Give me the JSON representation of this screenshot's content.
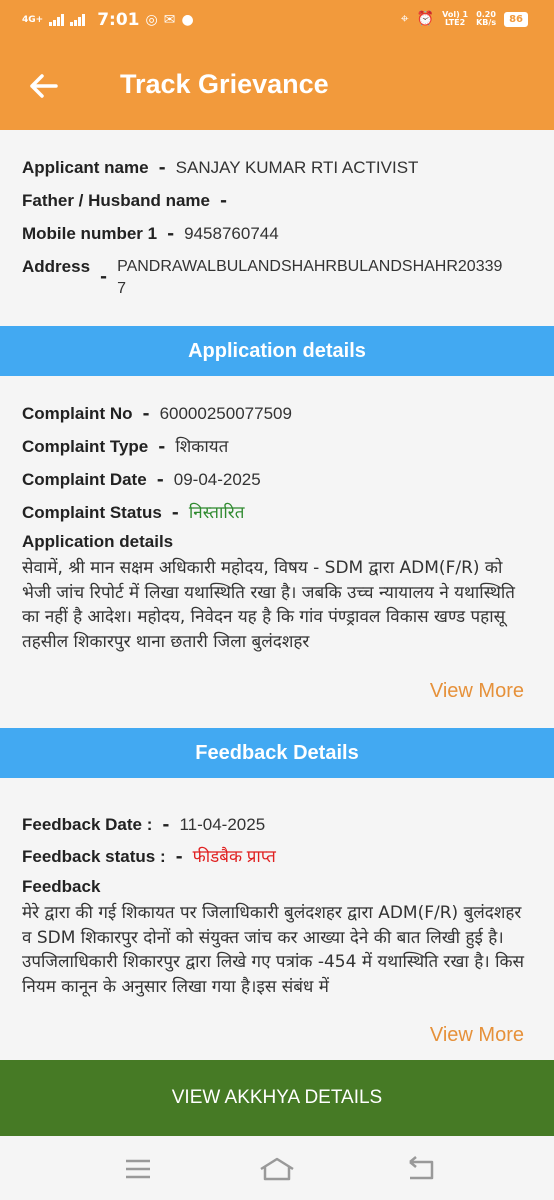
{
  "status_bar": {
    "network": "4G+",
    "time": "7:01",
    "volte": "Vol) 1",
    "lte": "LTE2",
    "speed": "0.20",
    "speed_unit": "KB/s",
    "battery": "86"
  },
  "app_bar": {
    "title": "Track Grievance"
  },
  "applicant": {
    "name_label": "Applicant name",
    "name_value": "SANJAY KUMAR RTI ACTIVIST",
    "father_label": "Father / Husband name",
    "father_value": "",
    "mobile_label": "Mobile number 1",
    "mobile_value": "9458760744",
    "address_label": "Address",
    "address_value": "PANDRAWALBULANDSHAHRBULANDSHAHR203397"
  },
  "application": {
    "section_title": "Application details",
    "complaint_no_label": "Complaint No",
    "complaint_no_value": "60000250077509",
    "complaint_type_label": "Complaint Type",
    "complaint_type_value": "शिकायत",
    "complaint_date_label": "Complaint Date",
    "complaint_date_value": "09-04-2025",
    "complaint_status_label": "Complaint Status",
    "complaint_status_value": "निस्तारित",
    "details_label": "Application details",
    "details_text": "सेवामें,            श्री मान सक्षम अधिकारी महोदय, विषय - SDM द्वारा ADM(F/R) को भेजी जांच रिपोर्ट में लिखा यथास्थिति रखा है। जबकि उच्च न्यायालय ने यथास्थिति का नहीं है आदेश। महोदय,            निवेदन यह है कि गांव पंण्ड्रावल विकास खण्ड पहासू तहसील शिकारपुर थाना छतारी जिला बुलंदशहर",
    "view_more": "View More"
  },
  "feedback": {
    "section_title": "Feedback Details",
    "date_label": "Feedback Date :",
    "date_value": "11-04-2025",
    "status_label": "Feedback status :",
    "status_value": "फीडबैक प्राप्त",
    "feedback_label": "Feedback",
    "feedback_text": "मेरे द्वारा की गई शिकायत पर जिलाधिकारी बुलंदशहर द्वारा ADM(F/R) बुलंदशहर व SDM शिकारपुर दोनों को संयुक्त जांच कर आख्या देने की बात लिखी हुई है।उपजिलाधिकारी शिकारपुर द्वारा लिखे गए पत्रांक -454 में यथास्थिति रखा है। किस नियम कानून के अनुसार लिखा गया है।इस संबंध में",
    "view_more": "View More"
  },
  "akkhya_button": "VIEW AKKHYA DETAILS",
  "colors": {
    "header": "#f29a3c",
    "section": "#42a9f2",
    "button": "#467a25",
    "link": "#e6913a",
    "status_green": "#2f8a2f",
    "status_red": "#e02020"
  },
  "icons": [
    "signal-icon",
    "whatsapp-icon",
    "mail-icon",
    "chat-icon",
    "location-icon",
    "alarm-icon",
    "battery-icon",
    "back-arrow-icon",
    "menu-icon",
    "home-icon",
    "back-icon"
  ]
}
